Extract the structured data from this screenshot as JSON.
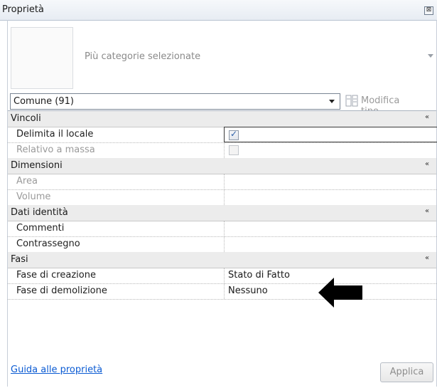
{
  "window": {
    "title": "Proprietà",
    "close_glyph": "⊠"
  },
  "type_selector": {
    "name": "Più categorie selezionate"
  },
  "filter": {
    "value": "Comune (91)",
    "edit_type_label": "Modifica tipo"
  },
  "groups": [
    {
      "label": "Vincoli",
      "rows": [
        {
          "label": "Delimita il locale",
          "value_type": "checkbox",
          "checked": true,
          "enabled": true
        },
        {
          "label": "Relativo a massa",
          "value_type": "checkbox",
          "checked": false,
          "enabled": false
        }
      ]
    },
    {
      "label": "Dimensioni",
      "rows": [
        {
          "label": "Area",
          "value": "",
          "enabled": false
        },
        {
          "label": "Volume",
          "value": "",
          "enabled": false
        }
      ]
    },
    {
      "label": "Dati identità",
      "rows": [
        {
          "label": "Commenti",
          "value": "",
          "enabled": true
        },
        {
          "label": "Contrassegno",
          "value": "",
          "enabled": true
        }
      ]
    },
    {
      "label": "Fasi",
      "rows": [
        {
          "label": "Fase di creazione",
          "value": "Stato di Fatto",
          "enabled": true
        },
        {
          "label": "Fase di demolizione",
          "value": "Nessuno",
          "enabled": true
        }
      ]
    }
  ],
  "collapse_glyph": "«",
  "footer": {
    "help_link": "Guida alle proprietà",
    "apply_label": "Applica"
  },
  "annotation": {
    "icon": "arrow-left-icon",
    "color": "#000000"
  }
}
